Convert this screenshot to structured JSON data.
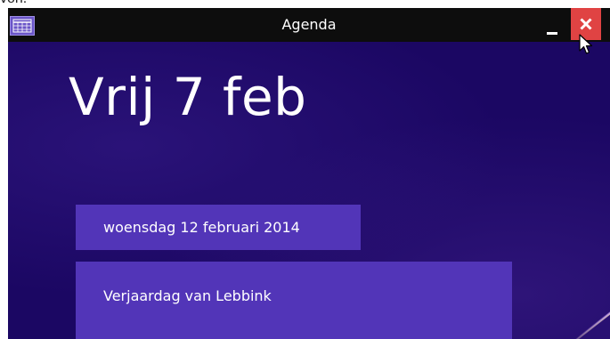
{
  "window": {
    "title": "Agenda",
    "icons": {
      "app": "calendar-icon",
      "minimize": "minimize-icon",
      "close": "close-icon",
      "cursor": "mouse-pointer-icon"
    },
    "colors": {
      "titlebar": "#0d0d0d",
      "background": "#1a0660",
      "tile": "#5235b8",
      "close": "#e04343"
    }
  },
  "top_crop_text": "von.",
  "main": {
    "day_heading": "Vrij 7 feb",
    "date_header": "woensdag 12 februari 2014",
    "event_title": "Verjaardag van Lebbink"
  }
}
